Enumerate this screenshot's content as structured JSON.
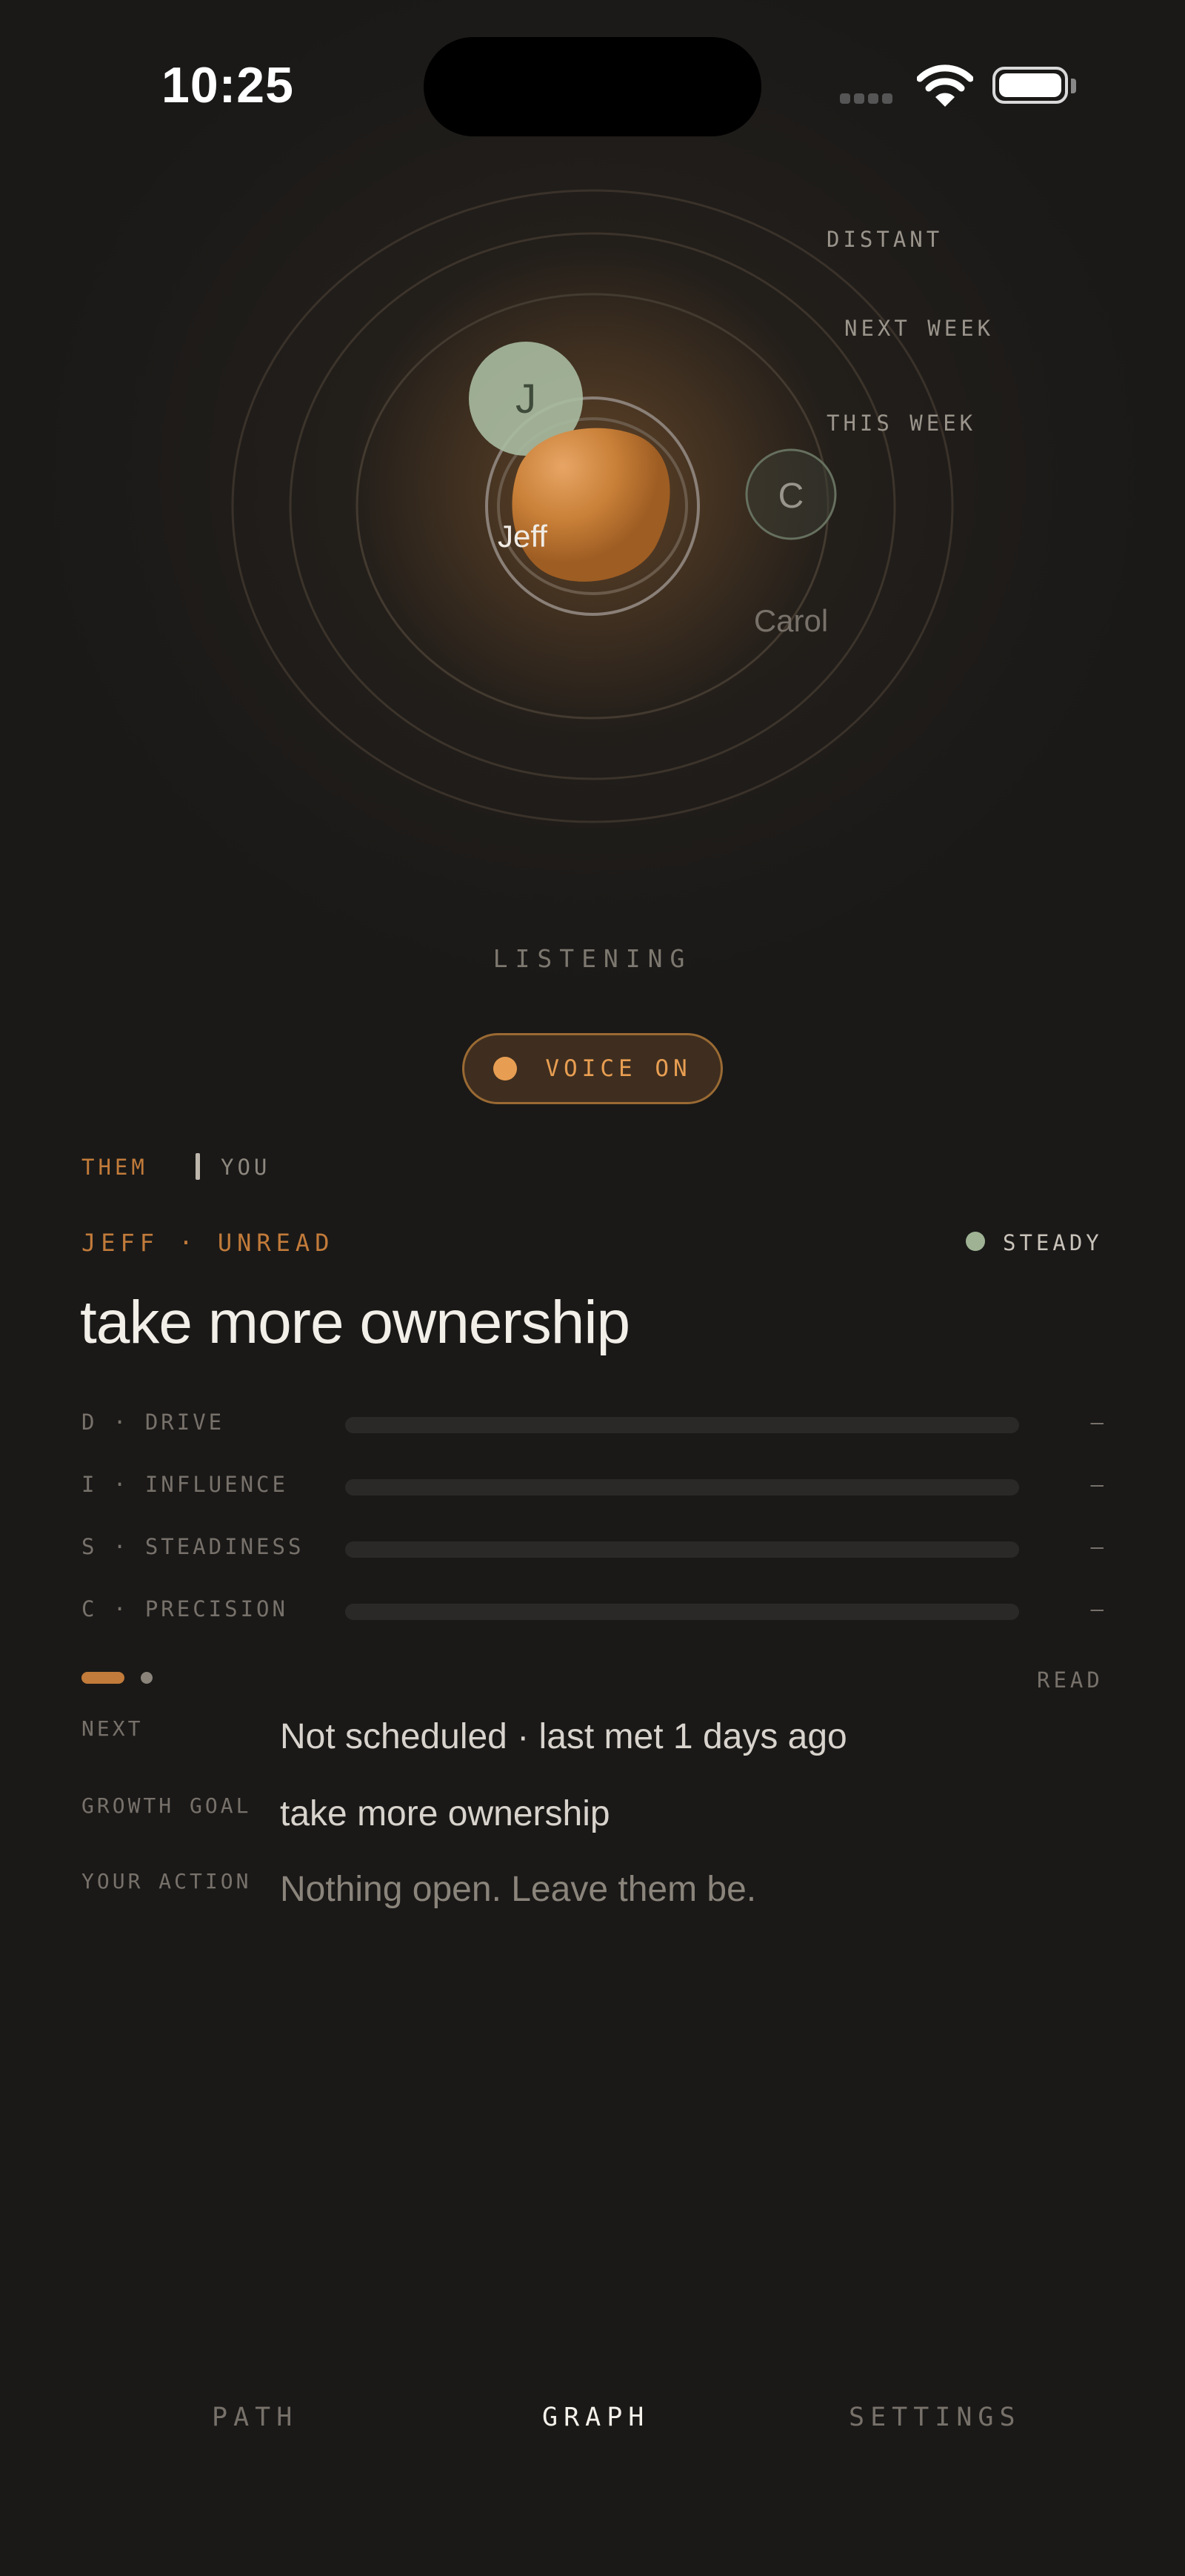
{
  "status_bar": {
    "time": "10:25"
  },
  "orbit": {
    "ring_labels": [
      "DISTANT",
      "NEXT WEEK",
      "THIS WEEK"
    ],
    "people": [
      {
        "initial": "J",
        "name": "Jeff",
        "ring": "THIS WEEK"
      },
      {
        "initial": "C",
        "name": "Carol",
        "ring": "THIS WEEK"
      }
    ],
    "center_color": "#c27b3a"
  },
  "state_label": "LISTENING",
  "voice_button": {
    "label": "VOICE ON"
  },
  "view_toggle": {
    "them": "THEM",
    "you": "YOU",
    "selected": "THEM"
  },
  "profile": {
    "person_line": "JEFF · UNREAD",
    "status": "STEADY",
    "headline": "take more ownership",
    "disc": [
      {
        "label": "D · DRIVE",
        "value": "—"
      },
      {
        "label": "I · INFLUENCE",
        "value": "—"
      },
      {
        "label": "S · STEADINESS",
        "value": "—"
      },
      {
        "label": "C · PRECISION",
        "value": "—"
      }
    ],
    "read_label": "READ",
    "info": [
      {
        "label": "NEXT",
        "value": "Not scheduled · last met 1 days ago"
      },
      {
        "label": "GROWTH GOAL",
        "value": "take more ownership"
      },
      {
        "label": "YOUR ACTION",
        "value": "Nothing open. Leave them be."
      }
    ]
  },
  "bottom_nav": {
    "items": [
      "PATH",
      "GRAPH",
      "SETTINGS"
    ],
    "active": "GRAPH"
  },
  "colors": {
    "accent": "#c27b3a",
    "background": "#1a1918",
    "steady": "#9fb394"
  }
}
